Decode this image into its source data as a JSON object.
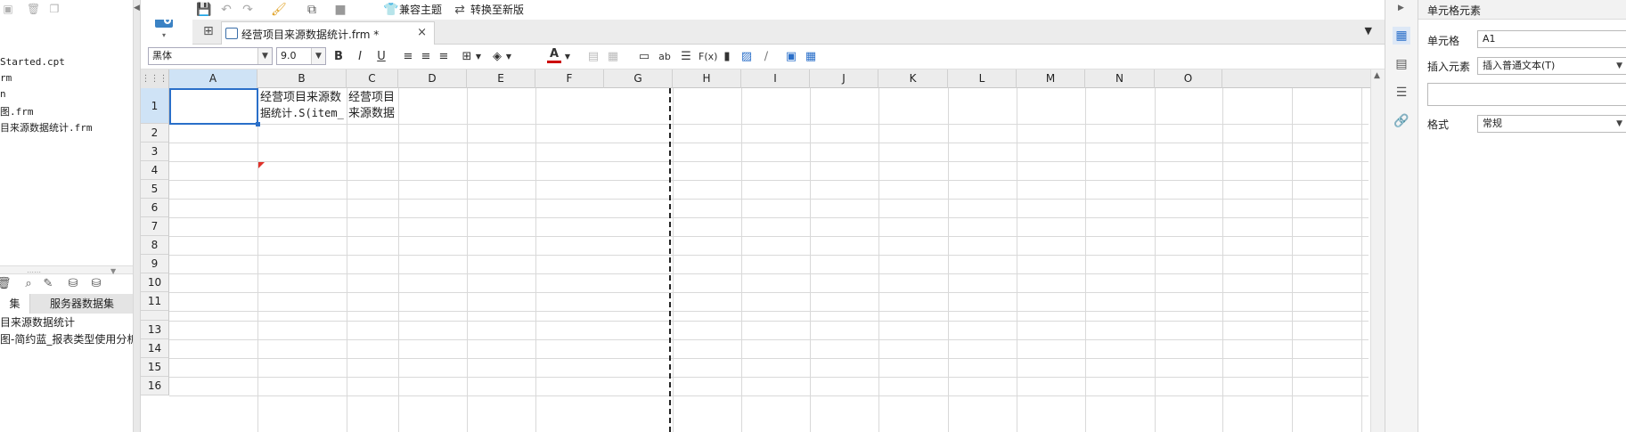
{
  "left_panel": {
    "tree_items": [
      "Started.cpt",
      "rm",
      "n",
      "图.frm",
      "目来源数据统计.frm"
    ],
    "dataset_tabs": [
      "集",
      "服务器数据集"
    ],
    "dataset_items": [
      "目来源数据统计",
      "图-简约蓝_报表类型使用分析"
    ]
  },
  "toolbar": {
    "compat_theme": "兼容主题",
    "convert_new": "转换至新版"
  },
  "document_tab": {
    "title": "经营项目来源数据统计.frm *",
    "close": "×"
  },
  "format_bar": {
    "font_family": "黑体",
    "font_size": "9.0",
    "bold": "B",
    "italic": "I",
    "underline": "U",
    "text_ab": "ab",
    "fx": "F(x)"
  },
  "grid": {
    "columns": [
      "A",
      "B",
      "C",
      "D",
      "E",
      "F",
      "G",
      "H",
      "I",
      "J",
      "K",
      "L",
      "M",
      "N",
      "O"
    ],
    "rows": [
      "1",
      "2",
      "3",
      "4",
      "5",
      "6",
      "7",
      "8",
      "9",
      "10",
      "11",
      "13",
      "14",
      "15",
      "16"
    ],
    "cells": {
      "B1_line1": "经营项目来源数",
      "B1_line2": "据统计.S(item_",
      "C1_line1": "经营项目",
      "C1_line2": "来源数据"
    },
    "selected_cell": "A1"
  },
  "right_panel": {
    "title": "单元格元素",
    "cell_label": "单元格",
    "cell_value": "A1",
    "insert_label": "插入元素",
    "insert_value": "插入普通文本(T)",
    "format_label": "格式",
    "format_value": "常规"
  },
  "colors": {
    "accent": "#2a6fc9",
    "selected_header": "#cfe3f6"
  }
}
